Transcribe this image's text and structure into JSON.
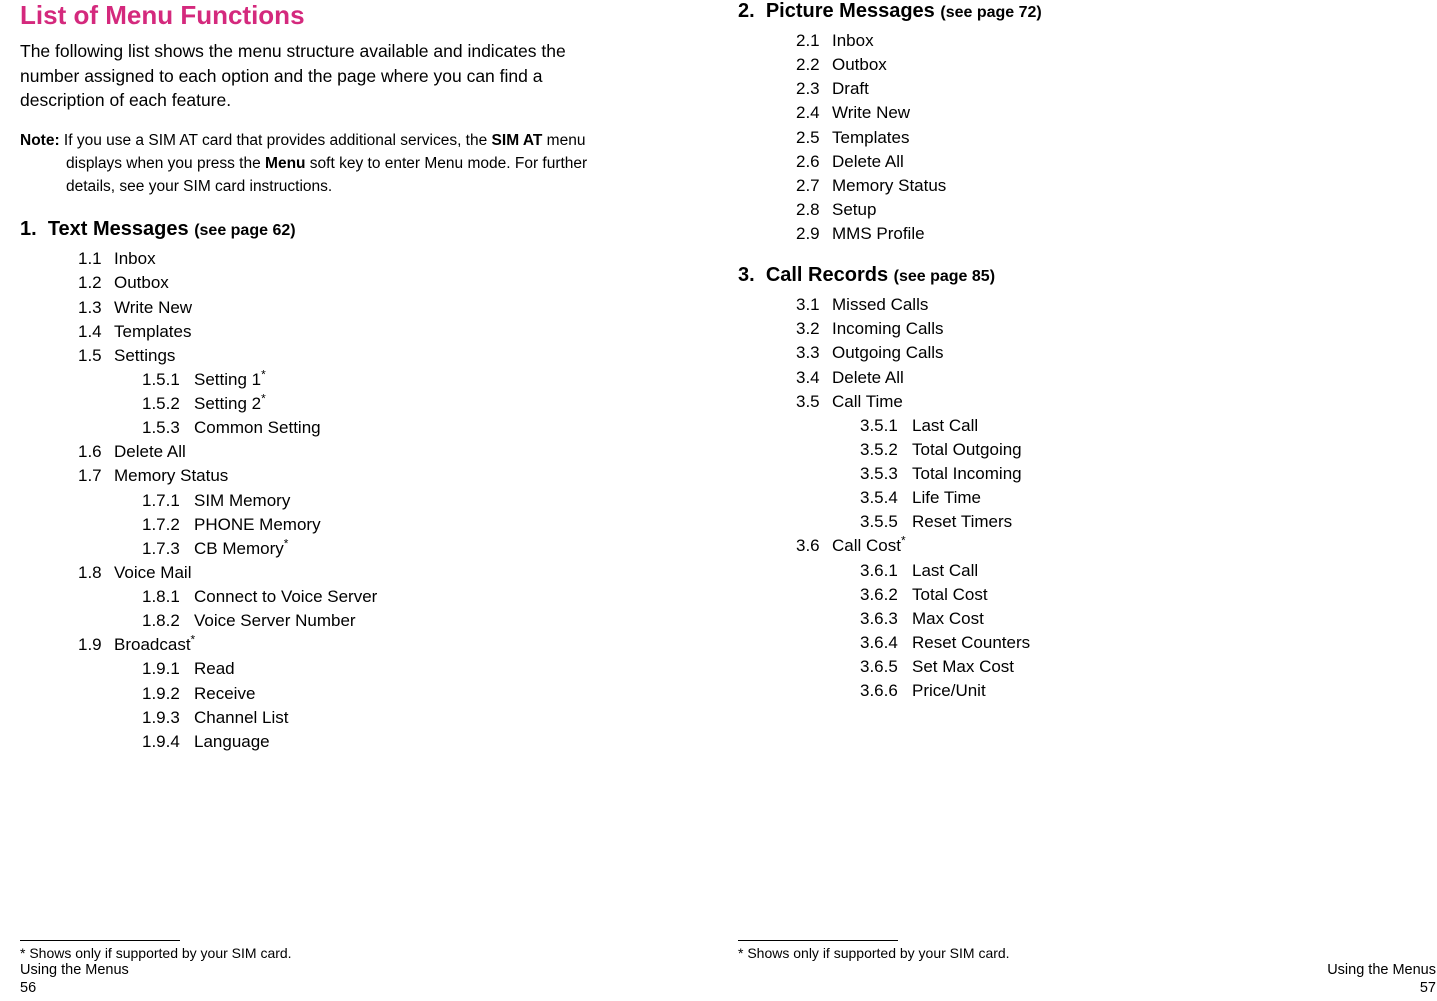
{
  "left": {
    "title": "List of Menu Functions",
    "intro": "The following list shows the menu structure available and indicates the number assigned to each option and the page where you can find a description of each feature.",
    "note_label": "Note:",
    "note_text_1": " If you use a SIM AT card that provides additional services, the ",
    "note_bold": "SIM AT",
    "note_text_2": " menu displays when you press the ",
    "note_bold2": "Menu",
    "note_text_3": " soft key to enter Menu mode. For further details, see your SIM card instructions.",
    "section1_num": "1.",
    "section1_title": "Text Messages",
    "section1_pg": "(see page 62)",
    "items": {
      "i1": {
        "n": "1.1",
        "t": "Inbox"
      },
      "i2": {
        "n": "1.2",
        "t": "Outbox"
      },
      "i3": {
        "n": "1.3",
        "t": "Write New"
      },
      "i4": {
        "n": "1.4",
        "t": "Templates"
      },
      "i5": {
        "n": "1.5",
        "t": "Settings"
      },
      "i5_1": {
        "n": "1.5.1",
        "t": "Setting 1",
        "s": "*"
      },
      "i5_2": {
        "n": "1.5.2",
        "t": "Setting 2",
        "s": "*"
      },
      "i5_3": {
        "n": "1.5.3",
        "t": "Common Setting"
      },
      "i6": {
        "n": "1.6",
        "t": "Delete All"
      },
      "i7": {
        "n": "1.7",
        "t": "Memory Status"
      },
      "i7_1": {
        "n": "1.7.1",
        "t": "SIM Memory"
      },
      "i7_2": {
        "n": "1.7.2",
        "t": "PHONE Memory"
      },
      "i7_3": {
        "n": "1.7.3",
        "t": "CB Memory",
        "s": "*"
      },
      "i8": {
        "n": "1.8",
        "t": "Voice Mail"
      },
      "i8_1": {
        "n": "1.8.1",
        "t": "Connect to Voice Server"
      },
      "i8_2": {
        "n": "1.8.2",
        "t": "Voice Server Number"
      },
      "i9": {
        "n": "1.9",
        "t": "Broadcast",
        "s": "*"
      },
      "i9_1": {
        "n": "1.9.1",
        "t": "Read"
      },
      "i9_2": {
        "n": "1.9.2",
        "t": "Receive"
      },
      "i9_3": {
        "n": "1.9.3",
        "t": "Channel List"
      },
      "i9_4": {
        "n": "1.9.4",
        "t": "Language"
      }
    },
    "footnote": "* Shows only if supported by your SIM card.",
    "footer_title": "Using the Menus",
    "footer_page": "56"
  },
  "right": {
    "section2_num": "2.",
    "section2_title": "Picture Messages",
    "section2_pg": "(see page 72)",
    "s2": {
      "i1": {
        "n": "2.1",
        "t": "Inbox"
      },
      "i2": {
        "n": "2.2",
        "t": "Outbox"
      },
      "i3": {
        "n": "2.3",
        "t": "Draft"
      },
      "i4": {
        "n": "2.4",
        "t": "Write New"
      },
      "i5": {
        "n": "2.5",
        "t": "Templates"
      },
      "i6": {
        "n": "2.6",
        "t": "Delete All"
      },
      "i7": {
        "n": "2.7",
        "t": "Memory Status"
      },
      "i8": {
        "n": "2.8",
        "t": "Setup"
      },
      "i9": {
        "n": "2.9",
        "t": "MMS Profile"
      }
    },
    "section3_num": "3.",
    "section3_title": "Call Records",
    "section3_pg": "(see page 85)",
    "s3": {
      "i1": {
        "n": "3.1",
        "t": "Missed Calls"
      },
      "i2": {
        "n": "3.2",
        "t": "Incoming Calls"
      },
      "i3": {
        "n": "3.3",
        "t": "Outgoing Calls"
      },
      "i4": {
        "n": "3.4",
        "t": "Delete All"
      },
      "i5": {
        "n": "3.5",
        "t": "Call Time"
      },
      "i5_1": {
        "n": "3.5.1",
        "t": "Last Call"
      },
      "i5_2": {
        "n": "3.5.2",
        "t": "Total Outgoing"
      },
      "i5_3": {
        "n": "3.5.3",
        "t": "Total Incoming"
      },
      "i5_4": {
        "n": "3.5.4",
        "t": "Life Time"
      },
      "i5_5": {
        "n": "3.5.5",
        "t": "Reset Timers"
      },
      "i6": {
        "n": "3.6",
        "t": "Call Cost",
        "s": "*"
      },
      "i6_1": {
        "n": "3.6.1",
        "t": "Last Call"
      },
      "i6_2": {
        "n": "3.6.2",
        "t": "Total Cost"
      },
      "i6_3": {
        "n": "3.6.3",
        "t": "Max Cost"
      },
      "i6_4": {
        "n": "3.6.4",
        "t": "Reset Counters"
      },
      "i6_5": {
        "n": "3.6.5",
        "t": "Set Max Cost"
      },
      "i6_6": {
        "n": "3.6.6",
        "t": "Price/Unit"
      }
    },
    "footnote": "* Shows only if supported by your SIM card.",
    "footer_title": "Using the Menus",
    "footer_page": "57"
  }
}
